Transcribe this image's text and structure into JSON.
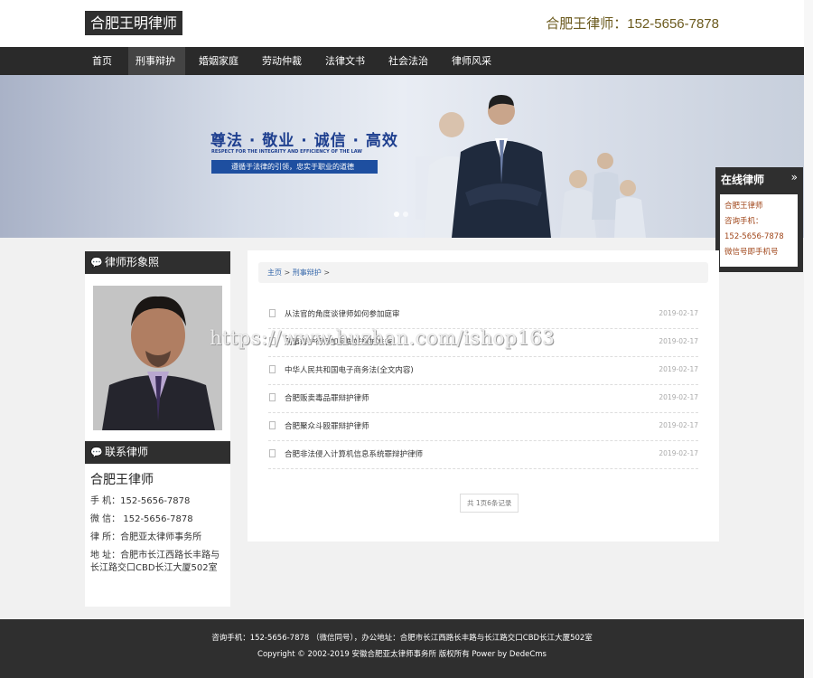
{
  "header": {
    "logo": "合肥王明律师",
    "hotline": "合肥王律师：152-5656-7878"
  },
  "nav": {
    "items": [
      {
        "label": "首页"
      },
      {
        "label": "刑事辩护"
      },
      {
        "label": "婚姻家庭"
      },
      {
        "label": "劳动仲裁"
      },
      {
        "label": "法律文书"
      },
      {
        "label": "社会法治"
      },
      {
        "label": "律师风采"
      }
    ]
  },
  "banner": {
    "slogan": "尊法 · 敬业 · 诚信 · 高效",
    "slogan_en": "RESPECT FOR THE INTEGRITY AND EFFICIENCY OF THE LAW",
    "slogan_box": "遵循于法律的引领，忠实于职业的道德"
  },
  "online": {
    "title": "在线律师",
    "arrow": "»",
    "lines": [
      "合肥王律师",
      "咨询手机：",
      "152-5656-7878",
      "微信号即手机号"
    ]
  },
  "sidebar": {
    "photo_title": "律师形象照",
    "contact_title": "联系律师",
    "contact_name": "合肥王律师",
    "phone": "手  机：152-5656-7878",
    "wechat": "微  信： 152-5656-7878",
    "office": "律  所：合肥亚太律师事务所",
    "address": "地  址：合肥市长江西路长丰路与长江路交口CBD长江大厦502室"
  },
  "main": {
    "crumb_home": "主页",
    "crumb_sep": " > ",
    "crumb_cat": "刑事辩护",
    "crumb_end": " >",
    "articles": [
      {
        "title": "从法官的角度谈律师如何参加庭审",
        "date": "2019-02-17"
      },
      {
        "title": "刑事辩护律师如何做好辩护准备",
        "date": "2019-02-17"
      },
      {
        "title": "中华人民共和国电子商务法(全文内容)",
        "date": "2019-02-17"
      },
      {
        "title": "合肥贩卖毒品罪辩护律师",
        "date": "2019-02-17"
      },
      {
        "title": "合肥聚众斗殴罪辩护律师",
        "date": "2019-02-17"
      },
      {
        "title": "合肥非法侵入计算机信息系统罪辩护律师",
        "date": "2019-02-17"
      }
    ],
    "pager": "共 1页6条记录"
  },
  "watermark": "https://www.huzhan.com/ishop163",
  "footer": {
    "line1": "咨询手机：152-5656-7878 （微信同号），办公地址：合肥市长江西路长丰路与长江路交口CBD长江大厦502室",
    "line2": "Copyright © 2002-2019 安徽合肥亚太律师事务所 版权所有 Power by DedeCms"
  },
  "colors": {
    "dark": "#2f2f2f",
    "accent_blue": "#1e3f8f",
    "online_text": "#a0461a"
  }
}
